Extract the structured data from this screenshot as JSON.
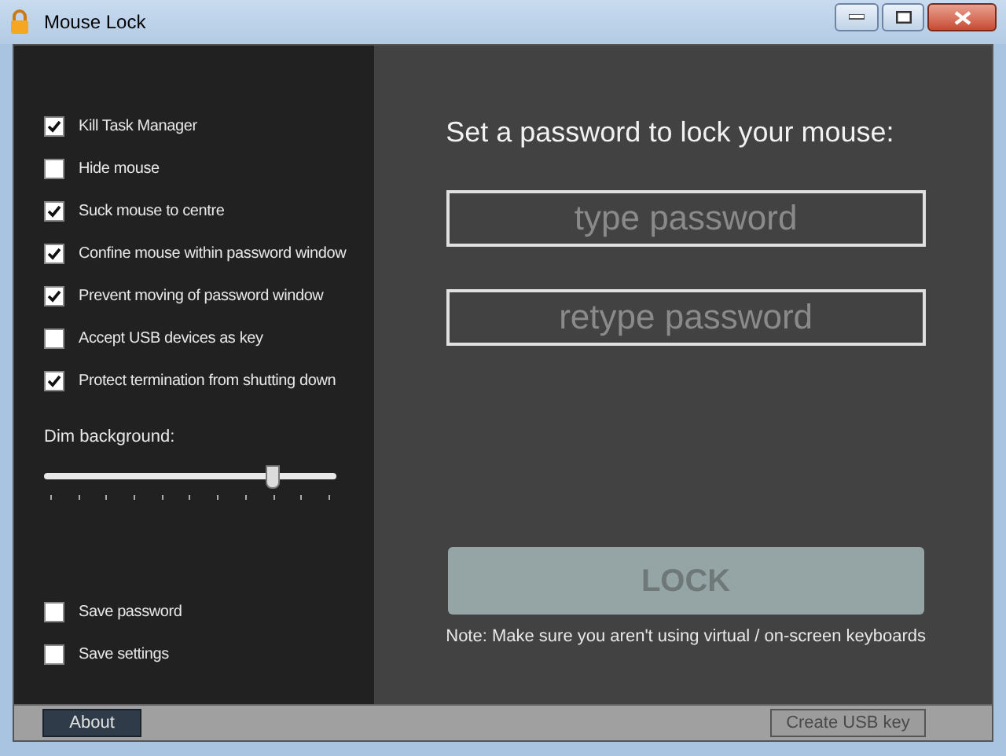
{
  "window": {
    "title": "Mouse Lock"
  },
  "options": [
    {
      "label": "Kill Task Manager",
      "checked": true
    },
    {
      "label": "Hide mouse",
      "checked": false
    },
    {
      "label": "Suck mouse to centre",
      "checked": true
    },
    {
      "label": "Confine mouse within password window",
      "checked": true
    },
    {
      "label": "Prevent moving of password window",
      "checked": true
    },
    {
      "label": "Accept USB devices as key",
      "checked": false
    },
    {
      "label": "Protect termination from shutting down",
      "checked": true
    }
  ],
  "dim_background": {
    "label": "Dim background:",
    "level": 0.78
  },
  "save_options": [
    {
      "label": "Save password",
      "checked": false
    },
    {
      "label": "Save settings",
      "checked": false
    }
  ],
  "heading": "Set a password to lock your mouse:",
  "password_field": {
    "placeholder": "type password"
  },
  "retype_field": {
    "placeholder": "retype password"
  },
  "lock_button": {
    "label": "LOCK",
    "disabled": true
  },
  "note": "Note: Make sure you aren't using virtual / on-screen keyboards",
  "about_button": {
    "label": "About",
    "disabled": false
  },
  "create_usb_button": {
    "label": "Create USB key",
    "disabled": true
  }
}
